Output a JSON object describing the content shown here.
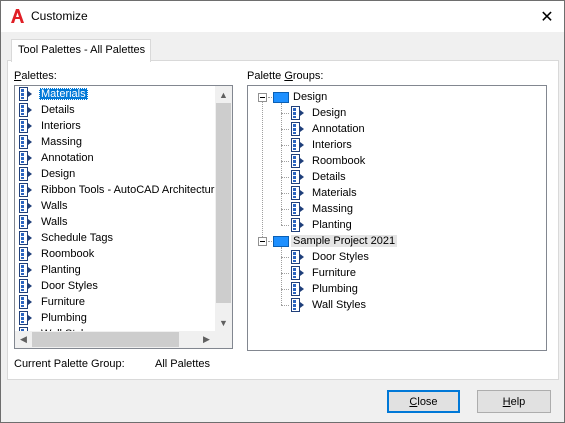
{
  "window": {
    "title": "Customize",
    "close_glyph": "✕",
    "app_icon": "autocad-a-icon"
  },
  "tab": {
    "label": "Tool Palettes - All Palettes"
  },
  "palettes": {
    "label_prefix": "",
    "label_accel": "P",
    "label_rest": "alettes:",
    "items": [
      "Materials",
      "Details",
      "Interiors",
      "Massing",
      "Annotation",
      "Design",
      "Ribbon Tools - AutoCAD Architecture",
      "Walls",
      "Walls",
      "Schedule Tags",
      "Roombook",
      "Planting",
      "Door Styles",
      "Furniture",
      "Plumbing",
      "Wall Styles"
    ],
    "selected_index": 0
  },
  "palette_groups": {
    "label_prefix": "Palette ",
    "label_accel": "G",
    "label_rest": "roups:",
    "groups": [
      {
        "name": "Design",
        "expanded": true,
        "children": [
          "Design",
          "Annotation",
          "Interiors",
          "Roombook",
          "Details",
          "Materials",
          "Massing",
          "Planting"
        ]
      },
      {
        "name": "Sample Project 2021",
        "expanded": true,
        "selected": true,
        "children": [
          "Door Styles",
          "Furniture",
          "Plumbing",
          "Wall Styles"
        ]
      }
    ]
  },
  "current_group": {
    "label": "Current Palette Group:",
    "value": "All Palettes"
  },
  "buttons": {
    "close_accel": "C",
    "close_rest": "lose",
    "help_accel": "H",
    "help_rest": "elp"
  },
  "scroll_arrows": {
    "up": "▲",
    "down": "▼",
    "left": "◀",
    "right": "▶"
  },
  "colors": {
    "accent": "#0078d7",
    "group_icon": "#1e90ff",
    "brand": "#e01f26"
  }
}
